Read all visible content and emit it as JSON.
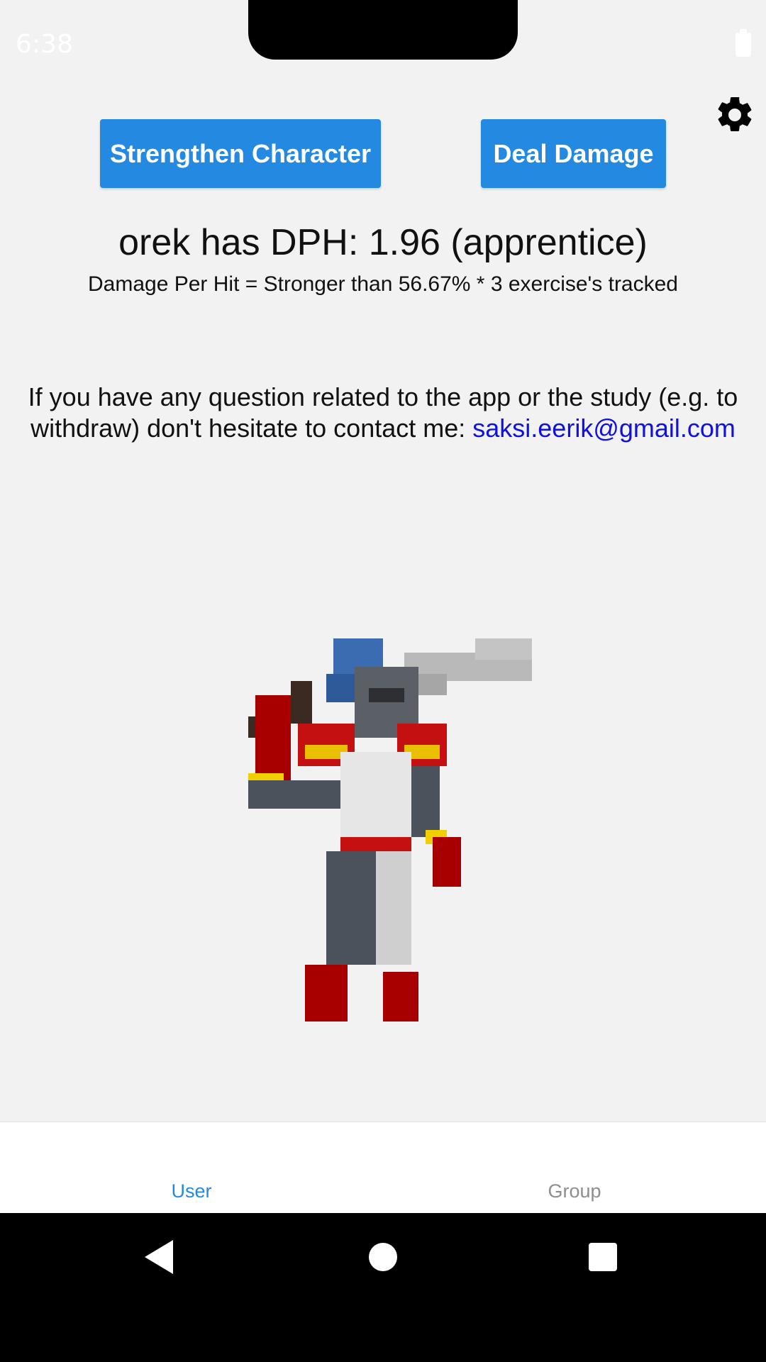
{
  "status_bar": {
    "time": "6:38",
    "battery_icon": "battery-icon"
  },
  "actions": {
    "strengthen_label": "Strengthen Character",
    "damage_label": "Deal Damage",
    "settings_icon": "gear-icon"
  },
  "stats": {
    "headline": "orek has DPH: 1.96 (apprentice)",
    "formula": "Damage Per Hit = Stronger than 56.67% * 3 exercise's tracked"
  },
  "contact": {
    "message": "If you have any question related to the app or the study (e.g. to withdraw) don't hesitate to contact me: ",
    "email": "saksi.eerik@gmail.com"
  },
  "character": {
    "icon": "pixel-knight-sprite"
  },
  "tabs": [
    {
      "label": "User",
      "active": true
    },
    {
      "label": "Group",
      "active": false
    }
  ],
  "colors": {
    "accent": "#2489e0",
    "link": "#1010e0",
    "background": "#f2f2f2",
    "inactive_tab": "#8e8e8e"
  }
}
